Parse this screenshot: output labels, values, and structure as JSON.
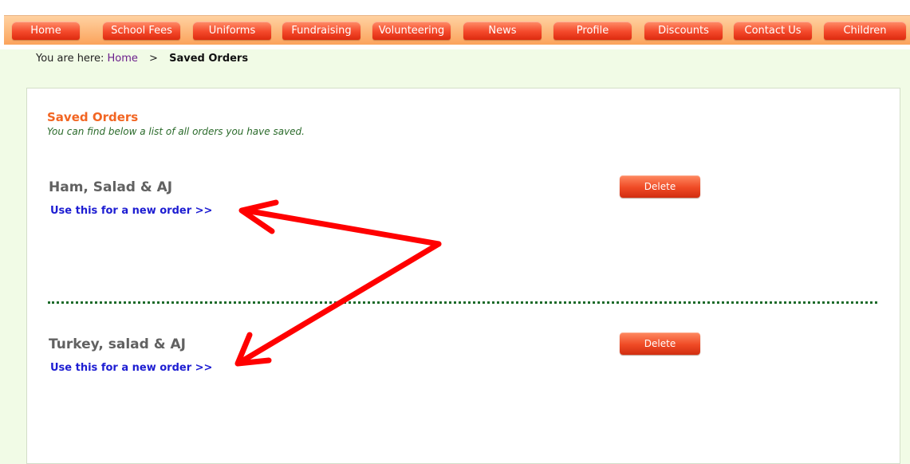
{
  "nav": {
    "items": [
      {
        "label": "Home"
      },
      {
        "label": "School Fees"
      },
      {
        "label": "Uniforms"
      },
      {
        "label": "Fundraising"
      },
      {
        "label": "Volunteering"
      },
      {
        "label": "News"
      },
      {
        "label": "Profile"
      },
      {
        "label": "Discounts"
      },
      {
        "label": "Contact Us"
      },
      {
        "label": "Children"
      }
    ]
  },
  "breadcrumb": {
    "prefix": "You are here:",
    "home": "Home",
    "separator": ">",
    "current": "Saved Orders"
  },
  "page": {
    "title": "Saved Orders",
    "subtitle": "You can find below a list of all orders you have saved."
  },
  "orders": [
    {
      "name": "Ham, Salad & AJ",
      "link": "Use this for a new order >>",
      "delete_label": "Delete"
    },
    {
      "name": "Turkey, salad & AJ",
      "link": "Use this for a new order >>",
      "delete_label": "Delete"
    }
  ],
  "colors": {
    "accent": "#f26522",
    "annotation": "#ff0000",
    "link": "#1d1dd2"
  }
}
